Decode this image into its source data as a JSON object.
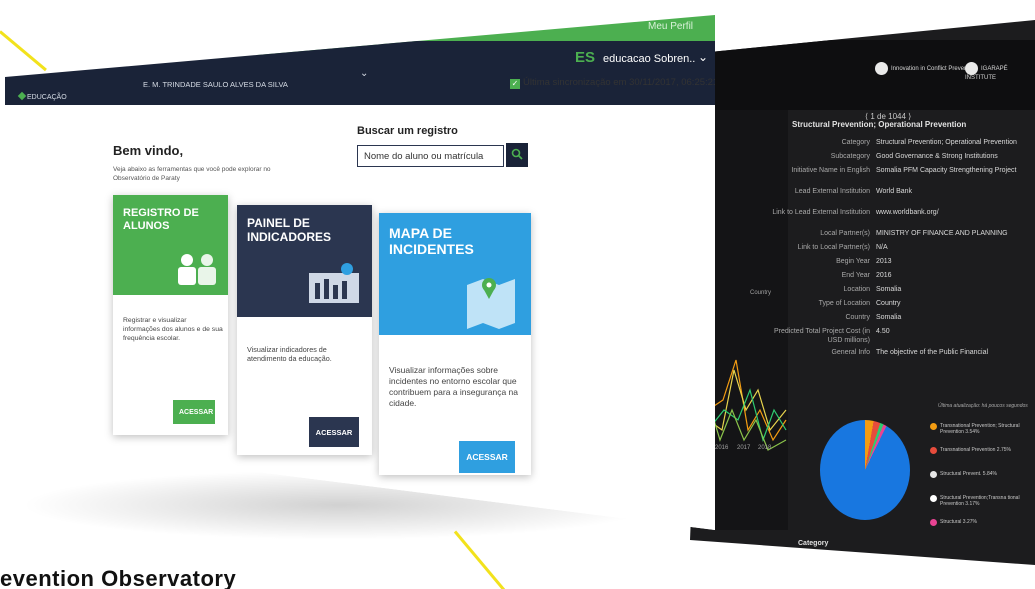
{
  "header": {
    "meu_perfil": "Meu Perfil",
    "nav_edu": "EDUCAÇÃO",
    "school": "E. M. TRINDADE SAULO ALVES DA SILVA",
    "es_badge": "ES",
    "user_name": "educacao Sobren..",
    "sync": "Última sincronização em 30/11/2017, 06:25:21"
  },
  "welcome": {
    "title": "Bem vindo,",
    "subtitle": "Veja abaixo as ferramentas que você pode explorar no Observatório de Paraty"
  },
  "search": {
    "label": "Buscar um registro",
    "placeholder": "Nome do aluno ou matrícula"
  },
  "cards": [
    {
      "title": "REGISTRO DE ALUNOS",
      "desc": "Registrar e visualizar informações dos alunos e de sua frequência escolar.",
      "button": "ACESSAR",
      "color": "#4caf50"
    },
    {
      "title": "PAINEL DE INDICADORES",
      "desc": "Visualizar indicadores de atendimento da educação.",
      "button": "ACESSAR",
      "color": "#2b3650"
    },
    {
      "title": "MAPA DE INCIDENTES",
      "desc": "Visualizar informações sobre incidentes no entorno escolar que contribuem para a insegurança na cidade.",
      "button": "ACESSAR",
      "color": "#2f9fe0"
    }
  ],
  "caption": "evention Observatory",
  "dark": {
    "brand1": "Innovation in Conflict Prevention",
    "brand2": "IGARAPÉ INSTITUTE",
    "pager": "⟨ 1 de 1044 ⟩",
    "struct_title": "Structural Prevention; Operational Prevention",
    "fields": [
      {
        "label": "Category",
        "value": "Structural Prevention; Operational Prevention"
      },
      {
        "label": "Subcategory",
        "value": "Good Governance & Strong Institutions"
      },
      {
        "label": "Initiative Name in English",
        "value": "Somalia PFM Capacity Strengthening Project"
      },
      {
        "label": "Lead External Institution",
        "value": "World Bank"
      },
      {
        "label": "Link to Lead External Institution",
        "value": "www.worldbank.org/"
      },
      {
        "label": "Local Partner(s)",
        "value": "MINISTRY OF FINANCE AND PLANNING"
      },
      {
        "label": "Link to Local Partner(s)",
        "value": "N/A"
      },
      {
        "label": "Begin Year",
        "value": "2013"
      },
      {
        "label": "End Year",
        "value": "2016"
      },
      {
        "label": "Location",
        "value": "Somalia"
      },
      {
        "label": "Type of Location",
        "value": "Country"
      },
      {
        "label": "Country",
        "value": "Somalia"
      },
      {
        "label": "Predicted Total Project Cost (in USD millions)",
        "value": "4.50"
      },
      {
        "label": "General Info",
        "value": "The objective of the Public Financial"
      }
    ],
    "update_note": "Última atualização: há poucos segundos",
    "axis_country": "Country",
    "years": [
      "2016",
      "2017",
      "2018"
    ],
    "category": "Category",
    "legend": [
      {
        "text": "Transnational Prevention; Structural Prevention 3.54%",
        "color": "#f39c12"
      },
      {
        "text": "Transnational Prevention 2.75%",
        "color": "#e74c3c"
      },
      {
        "text": "Structural Prevent. 5.84%",
        "color": "#e6e6e6"
      },
      {
        "text": "Structural Prevention;Transna tional Prevention 3.17%",
        "color": "#ffffff"
      },
      {
        "text": "Structural 3.27%",
        "color": "#e84393"
      }
    ]
  }
}
